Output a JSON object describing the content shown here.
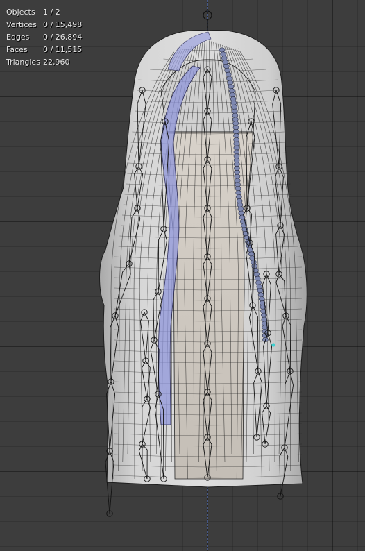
{
  "stats": {
    "objects": {
      "label": "Objects",
      "value": "1 / 2"
    },
    "vertices": {
      "label": "Vertices",
      "value": "0 / 15,498"
    },
    "edges": {
      "label": "Edges",
      "value": "0 / 26,894"
    },
    "faces": {
      "label": "Faces",
      "value": "0 / 11,515"
    },
    "triangles": {
      "label": "Triangles",
      "value": "22,960"
    }
  },
  "colors": {
    "viewport_bg": "#3d3d3d",
    "mesh_fill": "#c8c8c8",
    "wire": "#1e1e1e",
    "highlight_strand": "#8f95d9",
    "braid": "#6f7aa0",
    "axis": "#5b79c7",
    "selected_vertex": "#3fd0d0"
  }
}
